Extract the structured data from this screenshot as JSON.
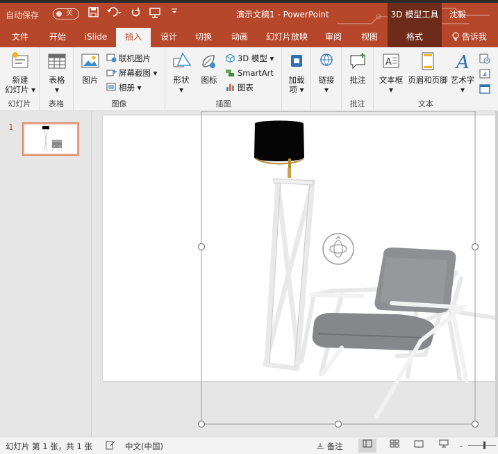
{
  "titlebar": {
    "autosave_label": "自动保存",
    "autosave_state": "关",
    "doc_title": "演示文稿1  -  PowerPoint",
    "context_tool": "3D 模型工具",
    "user": "沈毅"
  },
  "tabs": [
    "文件",
    "开始",
    "iSlide",
    "插入",
    "设计",
    "切换",
    "动画",
    "幻灯片放映",
    "审阅",
    "视图",
    "格式"
  ],
  "active_tab": "插入",
  "tell_me": "告诉我",
  "ribbon": {
    "slides": {
      "label": "幻灯片",
      "new_slide": "新建",
      "new_slide2": "幻灯片"
    },
    "tables": {
      "label": "表格",
      "table": "表格"
    },
    "images": {
      "label": "图像",
      "picture": "图片",
      "online_pictures": "联机图片",
      "screenshot": "屏幕截图",
      "album": "相册"
    },
    "illustrations": {
      "label": "插图",
      "shapes": "形状",
      "icons": "图标",
      "model3d": "3D 模型",
      "smartart": "SmartArt",
      "chart": "图表"
    },
    "addins": {
      "label": "加载项",
      "addins1": "加载",
      "addins2": "项"
    },
    "links": {
      "label": "链接",
      "link": "链接"
    },
    "comments": {
      "label": "批注",
      "comment": "批注"
    },
    "text": {
      "label": "文本",
      "textbox": "文本框",
      "header_footer": "页眉和页脚",
      "wordart": "艺术字"
    }
  },
  "slide_panel": {
    "number": "1"
  },
  "statusbar": {
    "slide_info": "幻灯片 第 1 张，共 1 张",
    "language": "中文(中国)",
    "notes": "备注",
    "zoom_minus": "-"
  },
  "colors": {
    "accent": "#b7472a",
    "context": "#6e2b1a"
  }
}
